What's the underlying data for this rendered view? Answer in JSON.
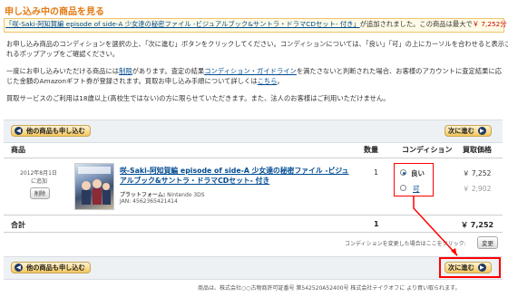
{
  "page_title": "申し込み中の商品を見る",
  "notice": {
    "product_link": "「咲-Saki-阿知賀編 episode of side-A 少女達の秘密ファイル -ビジュアルブック&サントラ・ドラマCDセット- 付き」",
    "suffix": "が追加されました。この商品は最大で",
    "price": "￥ 7,252分"
  },
  "intro": {
    "line1": "お申し込み商品のコンディションを選択の上、「次に進む」ボタンをクリックしてください。コンディションについては、「良い」「可」の上にカーソルを合わせると表示さ",
    "line2": "れるポップアップをご確認ください。",
    "line3_a": "一度にお申し込みいただける商品には",
    "line3_link": "制限",
    "line3_b": "があります。査定の結果",
    "line3_link2": "コンディション・ガイドライン",
    "line3_c": "を満たさないと判断された場合、お客様のアカウントに査定結果に応",
    "line4_a": "じた金額のAmazonギフト券が登録されます。買取お申し込み手順について詳しくは",
    "line4_link": "こちら",
    "line4_b": "。",
    "line5": "買取サービスのご利用は18歳以上(高校生ではない)の方に限らせていただきます。また、法人のお客様はご利用いただけません。"
  },
  "buttons": {
    "other_items": "他の商品も申し込む",
    "next": "次に進む",
    "change": "変更"
  },
  "table": {
    "headers": {
      "product": "商品",
      "quantity": "数量",
      "condition": "コンディション",
      "price": "買取価格"
    },
    "item": {
      "date_line1": "2012年8月1日",
      "date_line2": "に追加",
      "delete": "削除",
      "title_line1": "咲-Saki-阿知賀編 episode of side-A 少女達の秘密ファイル -ビジュ",
      "title_line2": "アルブック&サントラ・ドラマCDセット- 付き",
      "platform_label": "プラットフォーム:",
      "platform": "Nintendo 3DS",
      "jan": "JAN: 4562365421414",
      "quantity": "1",
      "conditions": [
        {
          "label": "良い",
          "price": "￥ 7,252",
          "selected": true
        },
        {
          "label": "可",
          "price": "￥ 2,902",
          "selected": false
        }
      ]
    },
    "total_label": "合計",
    "total_qty": "1",
    "total_price": "￥ 7,252",
    "change_prompt": "コンディションを変更した場合はここをクリック:"
  },
  "footer": {
    "text": "商品は、株式会社○○古物商許可証番号 第542520A52400号 株式会社テイクオフに より買い取られます。"
  },
  "colors": {
    "accent": "#e47911",
    "price_red": "#cc0000",
    "link": "#004b91",
    "annotation_red": "#ff0000"
  }
}
